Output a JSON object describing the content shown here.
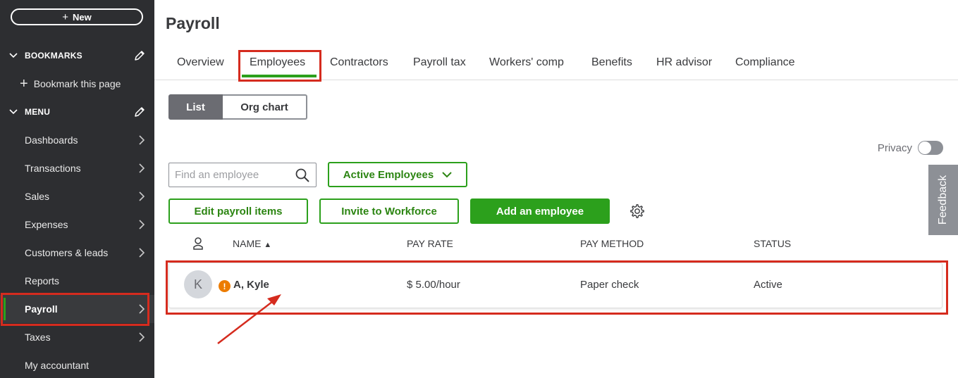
{
  "sidebar": {
    "new_label": "New",
    "bookmarks_header": "BOOKMARKS",
    "bookmark_this_page": "Bookmark this page",
    "menu_header": "MENU",
    "items": [
      {
        "label": "Dashboards",
        "has_arrow": true
      },
      {
        "label": "Transactions",
        "has_arrow": true
      },
      {
        "label": "Sales",
        "has_arrow": true
      },
      {
        "label": "Expenses",
        "has_arrow": true
      },
      {
        "label": "Customers & leads",
        "has_arrow": true
      },
      {
        "label": "Reports",
        "has_arrow": false
      },
      {
        "label": "Payroll",
        "has_arrow": true,
        "active": true
      },
      {
        "label": "Taxes",
        "has_arrow": true
      },
      {
        "label": "My accountant",
        "has_arrow": false
      }
    ]
  },
  "page": {
    "title": "Payroll",
    "tabs": [
      {
        "label": "Overview"
      },
      {
        "label": "Employees",
        "active": true
      },
      {
        "label": "Contractors"
      },
      {
        "label": "Payroll tax"
      },
      {
        "label": "Workers' comp"
      },
      {
        "label": "Benefits"
      },
      {
        "label": "HR advisor"
      },
      {
        "label": "Compliance"
      }
    ]
  },
  "view_toggle": {
    "list": "List",
    "org_chart": "Org chart",
    "selected": "List"
  },
  "privacy": {
    "label": "Privacy",
    "enabled": false
  },
  "feedback_label": "Feedback",
  "search": {
    "placeholder": "Find an employee",
    "value": ""
  },
  "filter_dropdown": {
    "label": "Active Employees"
  },
  "buttons": {
    "edit_payroll_items": "Edit payroll items",
    "invite_to_workforce": "Invite to Workforce",
    "add_employee": "Add an employee"
  },
  "table": {
    "columns": {
      "name": "NAME",
      "sort_indicator": "▲",
      "pay_rate": "PAY RATE",
      "pay_method": "PAY METHOD",
      "status": "STATUS"
    },
    "rows": [
      {
        "avatar_initial": "K",
        "warning": "!",
        "name": "A, Kyle",
        "pay_rate": "$ 5.00/hour",
        "pay_method": "Paper check",
        "status": "Active"
      }
    ]
  },
  "colors": {
    "sidebar_bg": "#2d2e31",
    "accent_green": "#2ca01c",
    "annotation_red": "#d52b1e",
    "warning_orange": "#ec7c00"
  }
}
